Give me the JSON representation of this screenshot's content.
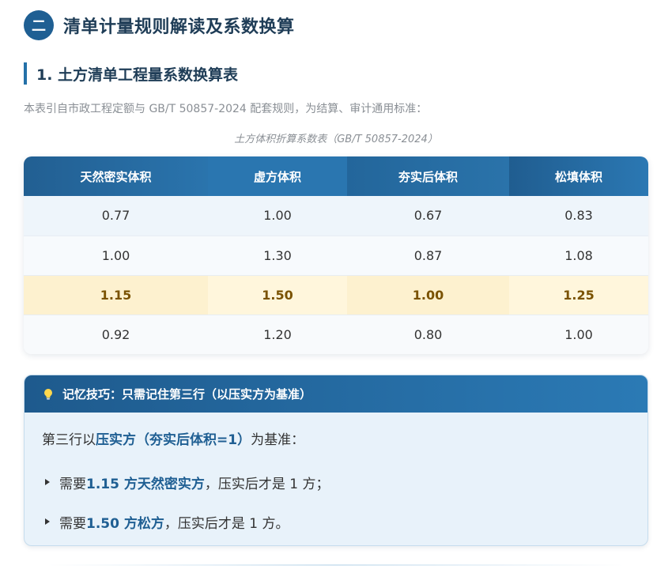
{
  "section": {
    "badge": "二",
    "title": "清单计量规则解读及系数换算"
  },
  "subsection": {
    "title": "1. 土方清单工程量系数换算表"
  },
  "intro": "本表引自市政工程定额与 GB/T 50857-2024 配套规则，为结算、审计通用标准：",
  "table": {
    "caption": "土方体积折算系数表（GB/T 50857-2024）",
    "headers": [
      "天然密实体积",
      "虚方体积",
      "夯实后体积",
      "松填体积"
    ],
    "rows": [
      [
        "0.77",
        "1.00",
        "0.67",
        "0.83"
      ],
      [
        "1.00",
        "1.30",
        "0.87",
        "1.08"
      ],
      [
        "1.15",
        "1.50",
        "1.00",
        "1.25"
      ],
      [
        "0.92",
        "1.20",
        "0.80",
        "1.00"
      ]
    ],
    "highlight_row": 2
  },
  "tip": {
    "icon": "lightbulb-icon",
    "title": "记忆技巧：只需记住第三行（以压实方为基准）",
    "line_prefix": "第三行以",
    "line_bold": "压实方（夯实后体积=1）",
    "line_suffix": "为基准：",
    "items": [
      {
        "prefix": "需要 ",
        "bold": "1.15 方天然密实方",
        "suffix": "，压实后才是 1 方；"
      },
      {
        "prefix": "需要 ",
        "bold": "1.50 方松方",
        "suffix": "，压实后才是 1 方。"
      }
    ]
  },
  "colors": {
    "primary": "#1f5f93",
    "highlight": "#fdf1cf",
    "highlight_text": "#7a5200"
  }
}
